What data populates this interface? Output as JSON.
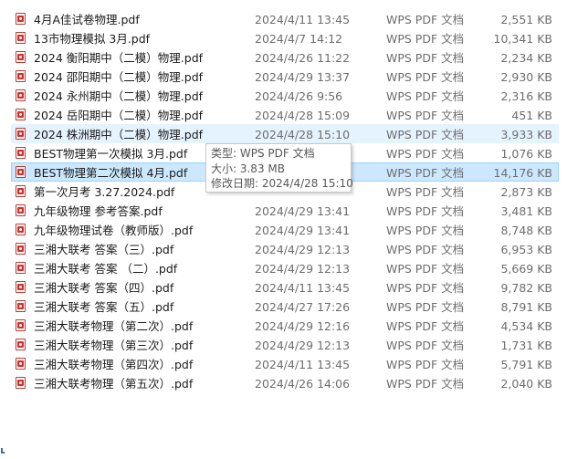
{
  "files": [
    {
      "name": "4月A佳试卷物理.pdf",
      "date": "2024/4/11 13:45",
      "type": "WPS PDF 文档",
      "size": "2,551 KB"
    },
    {
      "name": "13市物理模拟   3月.pdf",
      "date": "2024/4/7 14:12",
      "type": "WPS PDF 文档",
      "size": "10,341 KB"
    },
    {
      "name": "2024 衡阳期中（二模）物理.pdf",
      "date": "2024/4/26 11:22",
      "type": "WPS PDF 文档",
      "size": "2,234 KB"
    },
    {
      "name": "2024 邵阳期中（二模）物理.pdf",
      "date": "2024/4/29 13:37",
      "type": "WPS PDF 文档",
      "size": "2,930 KB"
    },
    {
      "name": "2024 永州期中（二模）物理.pdf",
      "date": "2024/4/26 9:56",
      "type": "WPS PDF 文档",
      "size": "2,316 KB"
    },
    {
      "name": "2024 岳阳期中（二模）物理.pdf",
      "date": "2024/4/28 15:09",
      "type": "WPS PDF 文档",
      "size": "451 KB"
    },
    {
      "name": "2024 株洲期中（二模）物理.pdf",
      "date": "2024/4/28 15:10",
      "type": "WPS PDF 文档",
      "size": "3,933 KB"
    },
    {
      "name": "BEST物理第一次模拟 3月.pdf",
      "date": "",
      "type": "WPS PDF 文档",
      "size": "1,076 KB"
    },
    {
      "name": "BEST物理第二次模拟 4月.pdf",
      "date": "",
      "type": "WPS PDF 文档",
      "size": "14,176 KB"
    },
    {
      "name": "第一次月考    3.27.2024.pdf",
      "date": "",
      "type": "WPS PDF 文档",
      "size": "2,873 KB"
    },
    {
      "name": "九年级物理  参考答案.pdf",
      "date": "2024/4/29 13:41",
      "type": "WPS PDF 文档",
      "size": "3,481 KB"
    },
    {
      "name": "九年级物理试卷（教师版）.pdf",
      "date": "2024/4/29 13:41",
      "type": "WPS PDF 文档",
      "size": "8,748 KB"
    },
    {
      "name": "三湘大联考     答案（三）.pdf",
      "date": "2024/4/29 12:13",
      "type": "WPS PDF 文档",
      "size": "6,953 KB"
    },
    {
      "name": "三湘大联考    答案 （二）.pdf",
      "date": "2024/4/29 12:13",
      "type": "WPS PDF 文档",
      "size": "5,669 KB"
    },
    {
      "name": "三湘大联考    答案（四）.pdf",
      "date": "2024/4/11 13:45",
      "type": "WPS PDF 文档",
      "size": "9,782 KB"
    },
    {
      "name": "三湘大联考    答案（五）.pdf",
      "date": "2024/4/27 17:26",
      "type": "WPS PDF 文档",
      "size": "8,791 KB"
    },
    {
      "name": "三湘大联考物理（第二次）.pdf",
      "date": "2024/4/29 12:16",
      "type": "WPS PDF 文档",
      "size": "4,534 KB"
    },
    {
      "name": "三湘大联考物理（第三次）.pdf",
      "date": "2024/4/29 12:13",
      "type": "WPS PDF 文档",
      "size": "1,731 KB"
    },
    {
      "name": "三湘大联考物理（第四次）.pdf",
      "date": "2024/4/11 13:45",
      "type": "WPS PDF 文档",
      "size": "5,791 KB"
    },
    {
      "name": "三湘大联考物理（第五次）.pdf",
      "date": "2024/4/26 14:06",
      "type": "WPS PDF 文档",
      "size": "2,040 KB"
    }
  ],
  "hover_index": 6,
  "selected_index": 8,
  "tooltip": {
    "type_line": "类型: WPS PDF 文档",
    "size_line": "大小: 3.83 MB",
    "modified_line": "修改日期: 2024/4/28 15:10"
  }
}
